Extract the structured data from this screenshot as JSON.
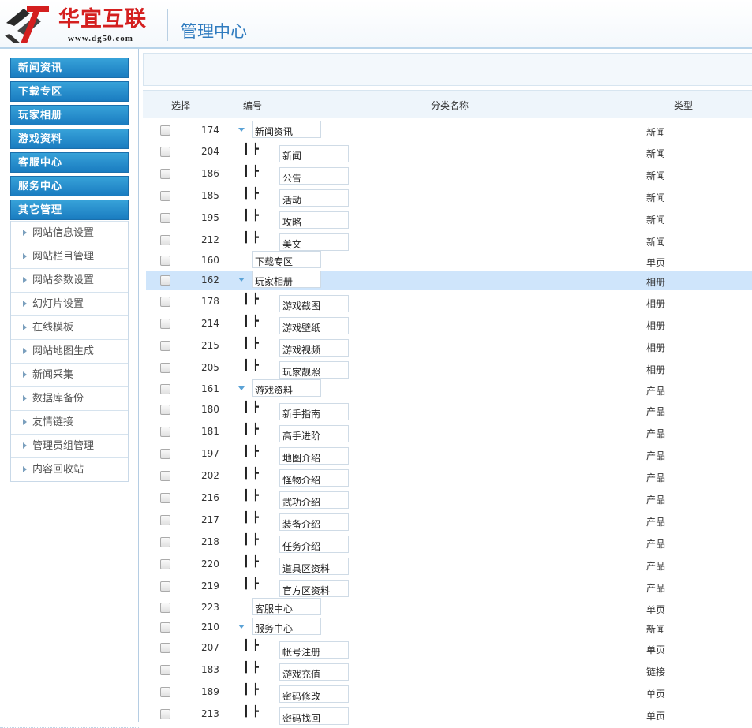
{
  "header": {
    "brand_name": "华宜互联",
    "brand_url": "www.dg50.com",
    "title": "管理中心"
  },
  "sidebar": {
    "menus": [
      {
        "label": "新闻资讯"
      },
      {
        "label": "下载专区"
      },
      {
        "label": "玩家相册"
      },
      {
        "label": "游戏资料"
      },
      {
        "label": "客服中心"
      },
      {
        "label": "服务中心"
      },
      {
        "label": "其它管理"
      }
    ],
    "sub_items": [
      {
        "label": "网站信息设置"
      },
      {
        "label": "网站栏目管理"
      },
      {
        "label": "网站参数设置"
      },
      {
        "label": "幻灯片设置"
      },
      {
        "label": "在线模板"
      },
      {
        "label": "网站地图生成"
      },
      {
        "label": "新闻采集"
      },
      {
        "label": "数据库备份"
      },
      {
        "label": "友情链接"
      },
      {
        "label": "管理员组管理"
      },
      {
        "label": "内容回收站"
      }
    ]
  },
  "table": {
    "columns": {
      "select": "选择",
      "id": "编号",
      "name": "分类名称",
      "type": "类型"
    },
    "rows": [
      {
        "id": "174",
        "name": "新闻资讯",
        "type": "新闻",
        "level": 0,
        "expanded": true
      },
      {
        "id": "204",
        "name": "新闻",
        "type": "新闻",
        "level": 1
      },
      {
        "id": "186",
        "name": "公告",
        "type": "新闻",
        "level": 1
      },
      {
        "id": "185",
        "name": "活动",
        "type": "新闻",
        "level": 1
      },
      {
        "id": "195",
        "name": "攻略",
        "type": "新闻",
        "level": 1
      },
      {
        "id": "212",
        "name": "美文",
        "type": "新闻",
        "level": 1
      },
      {
        "id": "160",
        "name": "下载专区",
        "type": "单页",
        "level": 0,
        "expanded": false
      },
      {
        "id": "162",
        "name": "玩家相册",
        "type": "相册",
        "level": 0,
        "expanded": true,
        "selected": true
      },
      {
        "id": "178",
        "name": "游戏截图",
        "type": "相册",
        "level": 1
      },
      {
        "id": "214",
        "name": "游戏壁纸",
        "type": "相册",
        "level": 1
      },
      {
        "id": "215",
        "name": "游戏视频",
        "type": "相册",
        "level": 1
      },
      {
        "id": "205",
        "name": "玩家靓照",
        "type": "相册",
        "level": 1
      },
      {
        "id": "161",
        "name": "游戏资料",
        "type": "产品",
        "level": 0,
        "expanded": true
      },
      {
        "id": "180",
        "name": "新手指南",
        "type": "产品",
        "level": 1
      },
      {
        "id": "181",
        "name": "高手进阶",
        "type": "产品",
        "level": 1
      },
      {
        "id": "197",
        "name": "地图介绍",
        "type": "产品",
        "level": 1
      },
      {
        "id": "202",
        "name": "怪物介绍",
        "type": "产品",
        "level": 1
      },
      {
        "id": "216",
        "name": "武功介绍",
        "type": "产品",
        "level": 1
      },
      {
        "id": "217",
        "name": "装备介绍",
        "type": "产品",
        "level": 1
      },
      {
        "id": "218",
        "name": "任务介绍",
        "type": "产品",
        "level": 1
      },
      {
        "id": "220",
        "name": "道具区资料",
        "type": "产品",
        "level": 1
      },
      {
        "id": "219",
        "name": "官方区资料",
        "type": "产品",
        "level": 1
      },
      {
        "id": "223",
        "name": "客服中心",
        "type": "单页",
        "level": 0,
        "expanded": false
      },
      {
        "id": "210",
        "name": "服务中心",
        "type": "新闻",
        "level": 0,
        "expanded": true
      },
      {
        "id": "207",
        "name": "帐号注册",
        "type": "单页",
        "level": 1
      },
      {
        "id": "183",
        "name": "游戏充值",
        "type": "链接",
        "level": 1
      },
      {
        "id": "189",
        "name": "密码修改",
        "type": "单页",
        "level": 1
      },
      {
        "id": "213",
        "name": "密码找回",
        "type": "单页",
        "level": 1
      }
    ],
    "tree_prefix": "┃ ┣"
  }
}
